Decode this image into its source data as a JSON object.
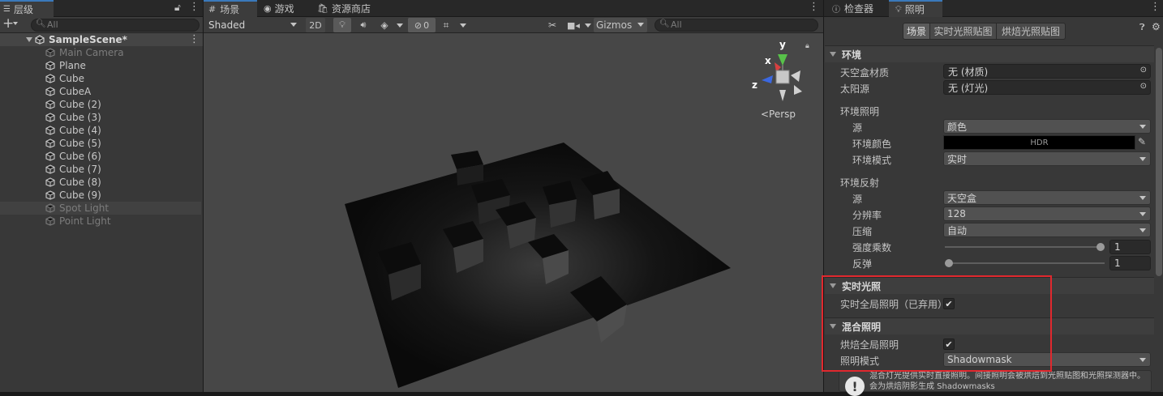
{
  "hierarchy": {
    "tab_label": "层级",
    "search_placeholder": "All",
    "add_label": "+",
    "scene_name": "SampleScene*",
    "items": [
      {
        "label": "Main Camera",
        "dim": true
      },
      {
        "label": "Plane",
        "dim": false
      },
      {
        "label": "Cube",
        "dim": false
      },
      {
        "label": "CubeA",
        "dim": false
      },
      {
        "label": "Cube (2)",
        "dim": false
      },
      {
        "label": "Cube (3)",
        "dim": false
      },
      {
        "label": "Cube (4)",
        "dim": false
      },
      {
        "label": "Cube (5)",
        "dim": false
      },
      {
        "label": "Cube (6)",
        "dim": false
      },
      {
        "label": "Cube (7)",
        "dim": false
      },
      {
        "label": "Cube (8)",
        "dim": false
      },
      {
        "label": "Cube (9)",
        "dim": false
      },
      {
        "label": "Spot Light",
        "dim": true
      },
      {
        "label": "Point Light",
        "dim": true
      }
    ]
  },
  "scene_tabs": {
    "scene": "场景",
    "game": "游戏",
    "asset_store": "资源商店"
  },
  "scene_toolbar": {
    "shading_mode": "Shaded",
    "mode_2d": "2D",
    "hidden_count": "0",
    "gizmos": "Gizmos",
    "search_placeholder": "All"
  },
  "scene_view": {
    "persp_label": "<Persp",
    "axis_x": "x",
    "axis_y": "y",
    "axis_z": "z"
  },
  "inspector_tabs": {
    "inspector": "检查器",
    "lighting": "照明"
  },
  "lighting": {
    "subtabs": [
      "场景",
      "实时光照贴图",
      "烘焙光照贴图"
    ],
    "environment": {
      "header": "环境",
      "skybox_label": "天空盒材质",
      "skybox_value": "无 (材质)",
      "sun_label": "太阳源",
      "sun_value": "无 (灯光)",
      "ambient_header": "环境照明",
      "source_label": "源",
      "source_value": "颜色",
      "ambient_color_label": "环境颜色",
      "ambient_color_value": "HDR",
      "ambient_color_hex": "#000000",
      "ambient_mode_label": "环境模式",
      "ambient_mode_value": "实时",
      "reflection_header": "环境反射",
      "refl_source_label": "源",
      "refl_source_value": "天空盒",
      "resolution_label": "分辨率",
      "resolution_value": "128",
      "compression_label": "压缩",
      "compression_value": "自动",
      "intensity_label": "强度乘数",
      "intensity_value": "1",
      "intensity_fraction": 1.0,
      "bounces_label": "反弹",
      "bounces_value": "1",
      "bounces_fraction": 0.0
    },
    "realtime": {
      "header": "实时光照",
      "gi_label": "实时全局照明（已弃用）",
      "gi_checked": true
    },
    "mixed": {
      "header": "混合照明",
      "baked_gi_label": "烘焙全局照明",
      "baked_gi_checked": true,
      "mode_label": "照明模式",
      "mode_value": "Shadowmask",
      "info_line1": "混合灯光提供实时直接照明。间接照明会被烘焙到光照贴图和光照探测器中。",
      "info_line2": "会为烘焙阴影生成 Shadowmasks"
    }
  },
  "colors": {
    "accent": "#3a79bb",
    "highlight_box": "#e0282e",
    "panel_bg": "#383838",
    "scene_bg": "#474747"
  }
}
